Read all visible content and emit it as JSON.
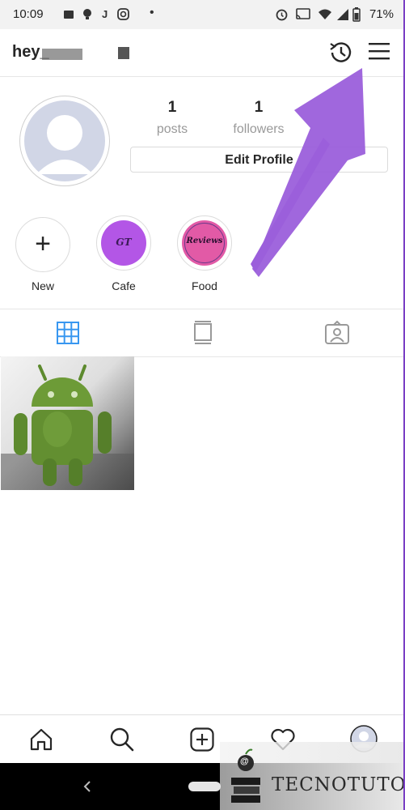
{
  "status_bar": {
    "time": "10:09",
    "battery": "71%",
    "dot": "•",
    "j_glyph": "J"
  },
  "header": {
    "username": "hey_"
  },
  "profile": {
    "posts_count": "1",
    "posts_label": "posts",
    "followers_count": "1",
    "followers_label": "followers",
    "edit_profile_label": "Edit Profile"
  },
  "highlights": [
    {
      "label": "New",
      "inner_text": "+"
    },
    {
      "label": "Cafe",
      "inner_text": "GT"
    },
    {
      "label": "Food",
      "inner_text": "Reviews"
    }
  ],
  "watermark": {
    "text": "TECNOTUTO",
    "at": "@"
  },
  "colors": {
    "accent_blue": "#3897f0",
    "arrow_purple": "#9b5fdb",
    "cafe_ring": "#c04ee0",
    "food_ring": "#e05ca8"
  },
  "icons": [
    "history-icon",
    "menu-icon",
    "grid-icon",
    "feed-view-icon",
    "tagged-icon",
    "home-icon",
    "search-icon",
    "add-icon",
    "heart-icon",
    "profile-icon"
  ]
}
